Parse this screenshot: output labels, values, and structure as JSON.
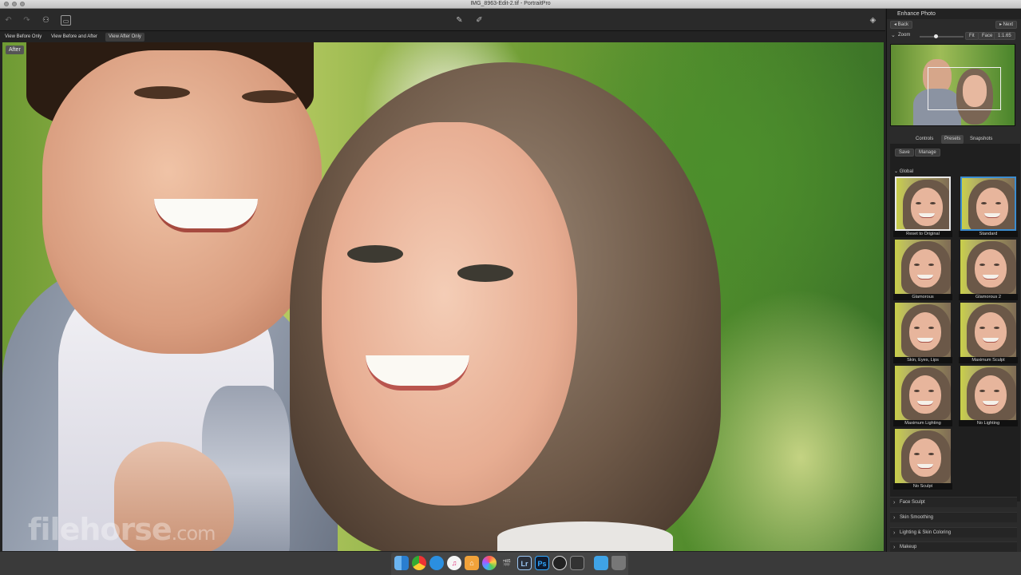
{
  "window": {
    "title": "IMG_8963-Edit-2.tif - PortraitPro"
  },
  "toolbar": {
    "left_icons": [
      "undo-icon",
      "redo-icon",
      "add-person-icon",
      "image-panel-icon"
    ],
    "center_icons": [
      "brush-restore-icon",
      "brush-apply-icon"
    ],
    "right_icons": [
      "layers-icon"
    ]
  },
  "view_tabs": [
    {
      "label": "View Before Only",
      "active": false
    },
    {
      "label": "View Before and After",
      "active": false
    },
    {
      "label": "View After Only",
      "active": true
    }
  ],
  "photo": {
    "badge": "After",
    "watermark_main": "filehorse",
    "watermark_suffix": ".com"
  },
  "panel": {
    "title": "Enhance Photo",
    "back_label": "◂ Back",
    "next_label": "▸ Next",
    "zoom_label": "Zoom",
    "zoom_fit": "Fit",
    "zoom_face": "Face",
    "zoom_ratio": "1:1.65",
    "tabs": [
      {
        "label": "Controls",
        "active": false
      },
      {
        "label": "Presets",
        "active": true
      },
      {
        "label": "Snapshots",
        "active": false
      }
    ],
    "save_label": "Save",
    "manage_label": "Manage",
    "global_label": "Global",
    "presets": [
      {
        "label": "Reset to Original",
        "state": "selected"
      },
      {
        "label": "Standard",
        "state": "active"
      },
      {
        "label": "Glamorous",
        "state": "none"
      },
      {
        "label": "Glamorous 2",
        "state": "none"
      },
      {
        "label": "Skin, Eyes, Lips",
        "state": "none"
      },
      {
        "label": "Maximum Sculpt",
        "state": "none"
      },
      {
        "label": "Maximum Lighting",
        "state": "none"
      },
      {
        "label": "No Lighting",
        "state": "none"
      },
      {
        "label": "No Sculpt",
        "state": "none"
      }
    ],
    "sections": [
      "Face Sculpt",
      "Skin Smoothing",
      "Lighting & Skin Coloring",
      "Makeup"
    ]
  },
  "dock": {
    "apps": [
      "finder-icon",
      "chrome-icon",
      "messenger-icon",
      "itunes-icon",
      "home-icon",
      "photos-icon",
      "final-cut-icon",
      "lightroom-icon",
      "photoshop-icon",
      "obs-icon",
      "portraitpro-icon",
      "folder-icon",
      "trash-icon"
    ],
    "labels": {
      "lightroom": "Lr",
      "photoshop": "Ps"
    }
  }
}
